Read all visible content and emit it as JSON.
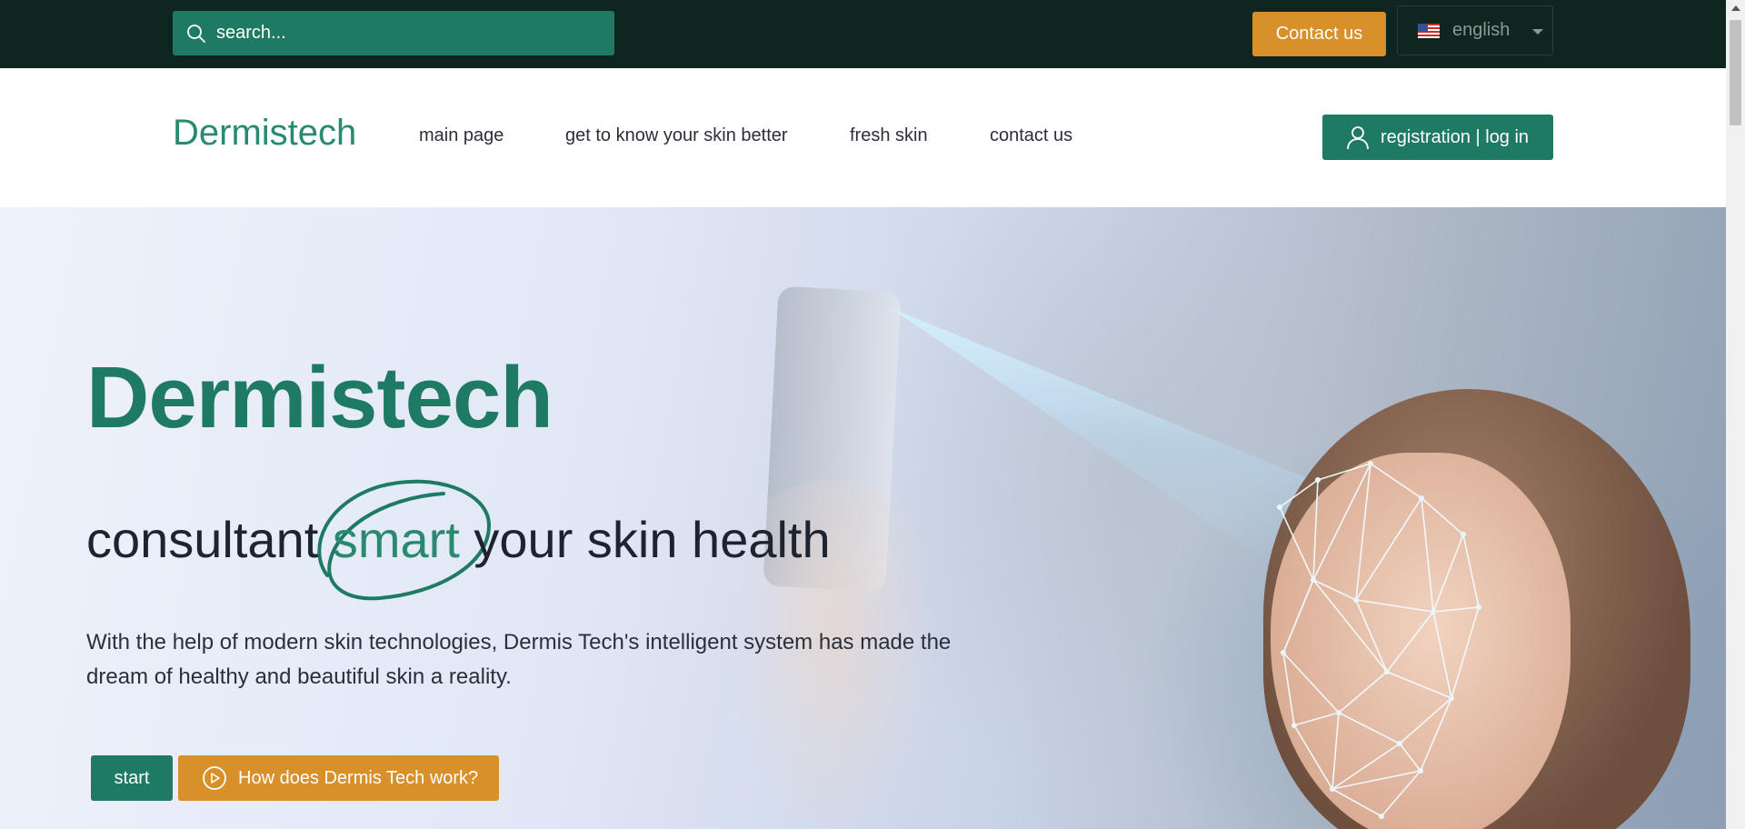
{
  "topbar": {
    "search_placeholder": "search...",
    "contact_label": "Contact us",
    "language": "english"
  },
  "nav": {
    "logo": "Dermistech",
    "items": [
      {
        "label": "main page"
      },
      {
        "label": "get to know your skin better"
      },
      {
        "label": "fresh skin"
      },
      {
        "label": "contact us"
      }
    ],
    "register_label": "registration | log in"
  },
  "hero": {
    "title": "Dermistech",
    "subtitle_before": "consultant ",
    "subtitle_accent": "smart",
    "subtitle_after": " your skin health",
    "description": "With the help of modern skin technologies, Dermis Tech's intelligent system has made the dream of healthy and beautiful skin a reality.",
    "start_label": "start",
    "how_label": "How does Dermis Tech work?"
  },
  "colors": {
    "topbar_bg": "#0f2620",
    "brand_green": "#1f7a64",
    "accent_orange": "#d8902a"
  },
  "icons": {
    "search": "search-icon",
    "flag": "us-flag-icon",
    "dropdown": "chevron-down-icon",
    "user": "user-icon",
    "play": "play-circle-icon"
  }
}
